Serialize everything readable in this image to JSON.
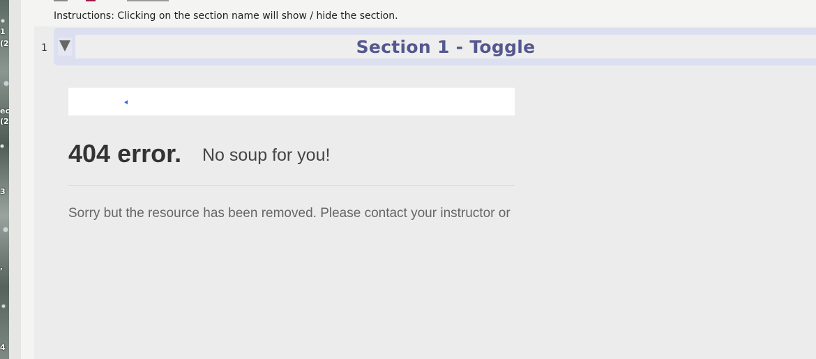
{
  "sidebar": {
    "labels": [
      "1",
      "(2",
      "ec",
      "(2",
      "3",
      ",",
      "4"
    ]
  },
  "instructions": "Instructions: Clicking on the section name will show / hide the section.",
  "section": {
    "number": "1",
    "title": "Section 1 - Toggle",
    "toggle_icon": "triangle-down-icon"
  },
  "error": {
    "title": "404 error.",
    "subtitle": "No soup for you!",
    "message": "Sorry but the resource has been removed. Please contact your instructor or"
  },
  "colors": {
    "section_title": "#55578f",
    "section_header_bg": "#dcdfef",
    "top_link": "#9a1b4b"
  }
}
